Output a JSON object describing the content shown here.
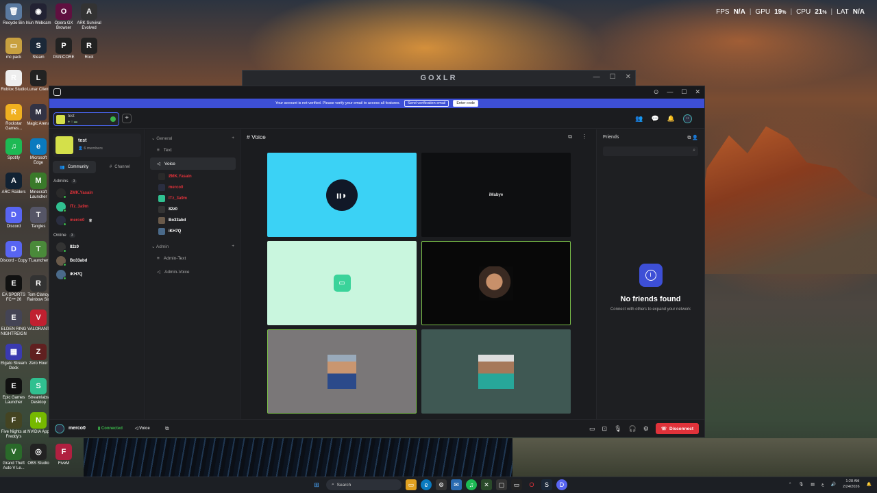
{
  "desktop": {
    "icons": [
      {
        "label": "Recycle Bin",
        "glyph": "🗑",
        "color": "#5a7aa0"
      },
      {
        "label": "Iriun Webcam",
        "glyph": "◉",
        "color": "#223"
      },
      {
        "label": "Opera GX Browser",
        "glyph": "O",
        "color": "#601040"
      },
      {
        "label": "ARK Survival Evolved",
        "glyph": "A",
        "color": "#333"
      },
      {
        "label": "mc pack",
        "glyph": "▭",
        "color": "#c8a040"
      },
      {
        "label": "Steam",
        "glyph": "S",
        "color": "#1b2838"
      },
      {
        "label": "PANICORE",
        "glyph": "P",
        "color": "#222"
      },
      {
        "label": "Root",
        "glyph": "R",
        "color": "#222"
      },
      {
        "label": "Roblox Studio",
        "glyph": "R",
        "color": "#eee"
      },
      {
        "label": "Lunar Client",
        "glyph": "L",
        "color": "#222"
      },
      {
        "label": "Rockstar Games...",
        "glyph": "R",
        "color": "#f0b020"
      },
      {
        "label": "Magic Arena",
        "glyph": "M",
        "color": "#334"
      },
      {
        "label": "Spotify",
        "glyph": "♫",
        "color": "#1db954"
      },
      {
        "label": "Microsoft Edge",
        "glyph": "e",
        "color": "#0a7abf"
      },
      {
        "label": "ARC Raiders",
        "glyph": "A",
        "color": "#123"
      },
      {
        "label": "Minecraft Launcher",
        "glyph": "M",
        "color": "#3a7a2a"
      },
      {
        "label": "Discord",
        "glyph": "D",
        "color": "#5865f2"
      },
      {
        "label": "Tangles",
        "glyph": "T",
        "color": "#556"
      },
      {
        "label": "Discord - Copy",
        "glyph": "D",
        "color": "#5865f2"
      },
      {
        "label": "TLauncher",
        "glyph": "T",
        "color": "#4a8a3a"
      },
      {
        "label": "EA SPORTS FC™ 26",
        "glyph": "E",
        "color": "#111"
      },
      {
        "label": "Tom Clancy Rainbow Six",
        "glyph": "R",
        "color": "#333"
      },
      {
        "label": "ELDEN RING NIGHTREIGN",
        "glyph": "E",
        "color": "#445"
      },
      {
        "label": "VALORANT",
        "glyph": "V",
        "color": "#c02030"
      },
      {
        "label": "Elgato Stream Deck",
        "glyph": "▦",
        "color": "#3a3ab0"
      },
      {
        "label": "Zero Hour",
        "glyph": "Z",
        "color": "#602020"
      },
      {
        "label": "Epic Games Launcher",
        "glyph": "E",
        "color": "#111"
      },
      {
        "label": "Streamlabs Desktop",
        "glyph": "S",
        "color": "#30c090"
      },
      {
        "label": "Five Nights at Freddy's",
        "glyph": "F",
        "color": "#442"
      },
      {
        "label": "NVIDIA App",
        "glyph": "N",
        "color": "#76b900"
      },
      {
        "label": "Grand Theft Auto V Le...",
        "glyph": "V",
        "color": "#2a6a2a"
      },
      {
        "label": "OBS Studio",
        "glyph": "◎",
        "color": "#222"
      },
      {
        "label": "FiveM",
        "glyph": "F",
        "color": "#b02040"
      }
    ]
  },
  "overlay": {
    "fps_label": "FPS",
    "fps": "N/A",
    "gpu_label": "GPU",
    "gpu": "19",
    "cpu_label": "CPU",
    "cpu": "21",
    "lat_label": "LAT",
    "lat": "N/A",
    "pct": "%"
  },
  "goxlr": {
    "title": "GOXLR"
  },
  "banner": {
    "text": "Your account is not verified. Please verify your email to access all features.",
    "send_btn": "Send verification email",
    "enter_btn": "Enter code"
  },
  "server_tab": {
    "name": "test"
  },
  "server": {
    "name": "test",
    "members": "6 members"
  },
  "tabs": {
    "community": "Community",
    "channel": "Channel"
  },
  "admins": {
    "label": "Admins",
    "count": "3",
    "members": [
      {
        "name": "ƵMK.Yasain",
        "color": "#e0323a",
        "avatar": "#2a2a2a"
      },
      {
        "name": "ITz_3a9m",
        "color": "#e0323a",
        "avatar": "#30c090"
      },
      {
        "name": "merco0",
        "color": "#e0323a",
        "avatar": "#2a2e40"
      }
    ]
  },
  "online": {
    "label": "Online",
    "count": "3",
    "members": [
      {
        "name": "82z0",
        "color": "#fff",
        "avatar": "#333"
      },
      {
        "name": "Bo33abd",
        "color": "#fff",
        "avatar": "#6a5a4a"
      },
      {
        "name": "iKH7Q",
        "color": "#fff",
        "avatar": "#4a6a8a"
      }
    ]
  },
  "channels": {
    "general": "General",
    "text": "Text",
    "voice": "Voice",
    "voice_members": [
      {
        "name": "ƵMK.Yasain",
        "color": "#e0323a",
        "av": "#2a2a2a"
      },
      {
        "name": "merco0",
        "color": "#e0323a",
        "av": "#2a2e40"
      },
      {
        "name": "ITz_3a9m",
        "color": "#e0323a",
        "av": "#30c090"
      },
      {
        "name": "82z0",
        "color": "#fff",
        "av": "#333"
      },
      {
        "name": "Bo33abd",
        "color": "#fff",
        "av": "#6a5a4a"
      },
      {
        "name": "iKH7Q",
        "color": "#fff",
        "av": "#4a6a8a"
      }
    ],
    "admin": "Admin",
    "admin_text": "Admin-Text",
    "admin_voice": "Admin-Voice"
  },
  "voice": {
    "title": "# Voice",
    "tile_name": "iMabye"
  },
  "friends": {
    "title": "Friends",
    "empty_title": "No friends found",
    "empty_sub": "Connect with others to expand your network"
  },
  "status": {
    "user": "merco0",
    "connected": "Connected",
    "channel": "Voice",
    "disconnect": "Disconnect"
  },
  "taskbar": {
    "search": "Search",
    "time": "1:28 AM",
    "date": "2/24/2026"
  }
}
